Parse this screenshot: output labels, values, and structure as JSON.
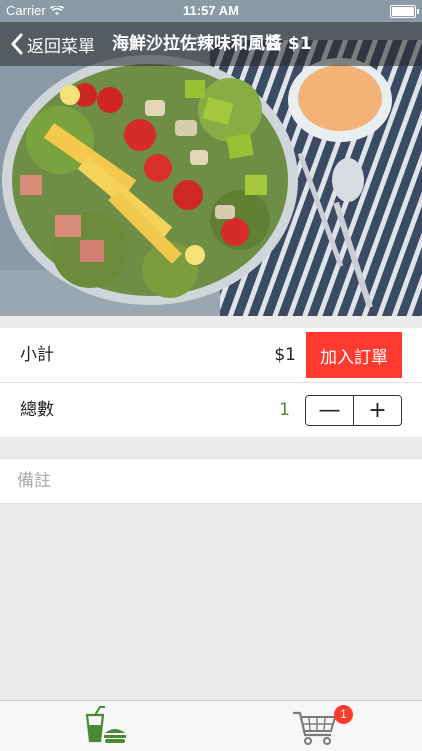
{
  "status_bar": {
    "carrier": "Carrier",
    "time": "11:57 AM",
    "wifi_icon": "wifi-icon",
    "battery_icon": "battery-icon"
  },
  "nav": {
    "back_label": "返回菜單",
    "back_icon": "chevron-left-icon",
    "title": "海鮮沙拉佐辣味和風醬 $1"
  },
  "hero_image": {
    "subject": "salad-photo"
  },
  "order": {
    "subtotal_label": "小計",
    "subtotal_value": "$1",
    "add_button_label": "加入訂單",
    "quantity_label": "總數",
    "quantity_value": "1",
    "decrement_label": "—",
    "increment_label": "+"
  },
  "notes": {
    "placeholder": "備註",
    "value": ""
  },
  "tab_bar": {
    "menu_icon": "drink-burger-icon",
    "cart_icon": "shopping-cart-icon",
    "cart_badge": "1"
  },
  "colors": {
    "accent_red": "#ff3b30",
    "quantity_green": "#4a8a32",
    "tab_icon_green": "#4a8a32",
    "cart_icon_gray": "#7a7a7a"
  }
}
